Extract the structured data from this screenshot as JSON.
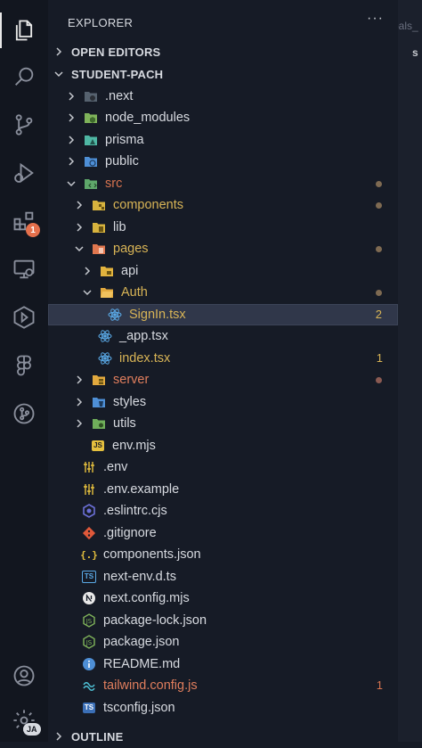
{
  "sidebar": {
    "title": "EXPLORER",
    "more": "···",
    "sections": {
      "open_editors": "OPEN EDITORS",
      "project": "STUDENT-PACH",
      "outline": "OUTLINE"
    }
  },
  "activity": {
    "extensions_badge": "1",
    "account_initials": "JA"
  },
  "editor": {
    "tab_fragment": "pals_",
    "tab_letter": "s"
  },
  "tree": [
    {
      "label": ".next",
      "icon": "folder-next-icon"
    },
    {
      "label": "node_modules",
      "icon": "folder-node-icon"
    },
    {
      "label": "prisma",
      "icon": "folder-prisma-icon"
    },
    {
      "label": "public",
      "icon": "folder-public-icon"
    },
    {
      "label": "src",
      "icon": "folder-src-icon"
    },
    {
      "label": "components",
      "icon": "folder-components-icon"
    },
    {
      "label": "lib",
      "icon": "folder-lib-icon"
    },
    {
      "label": "pages",
      "icon": "folder-pages-icon"
    },
    {
      "label": "api",
      "icon": "folder-api-icon"
    },
    {
      "label": "Auth",
      "icon": "folder-open-icon"
    },
    {
      "label": "SignIn.tsx",
      "icon": "react-icon",
      "count": "2"
    },
    {
      "label": "_app.tsx",
      "icon": "react-icon"
    },
    {
      "label": "index.tsx",
      "icon": "react-icon",
      "count": "1"
    },
    {
      "label": "server",
      "icon": "folder-server-icon"
    },
    {
      "label": "styles",
      "icon": "folder-styles-icon"
    },
    {
      "label": "utils",
      "icon": "folder-utils-icon"
    },
    {
      "label": "env.mjs",
      "icon": "js-icon"
    },
    {
      "label": ".env",
      "icon": "env-icon"
    },
    {
      "label": ".env.example",
      "icon": "env-icon"
    },
    {
      "label": ".eslintrc.cjs",
      "icon": "eslint-icon"
    },
    {
      "label": ".gitignore",
      "icon": "git-icon"
    },
    {
      "label": "components.json",
      "icon": "json-icon"
    },
    {
      "label": "next-env.d.ts",
      "icon": "ts-icon"
    },
    {
      "label": "next.config.mjs",
      "icon": "next-icon"
    },
    {
      "label": "package-lock.json",
      "icon": "node-icon"
    },
    {
      "label": "package.json",
      "icon": "node-icon"
    },
    {
      "label": "README.md",
      "icon": "info-icon"
    },
    {
      "label": "tailwind.config.js",
      "icon": "tailwind-icon",
      "count": "1"
    },
    {
      "label": "tsconfig.json",
      "icon": "ts-icon"
    }
  ],
  "colors": {
    "background": "#161b26",
    "activity_bar": "#12161f",
    "selection": "#30374a",
    "modified_yellow": "#d8b456",
    "modified_orange": "#d7734f",
    "folder": "#e2a93e"
  }
}
